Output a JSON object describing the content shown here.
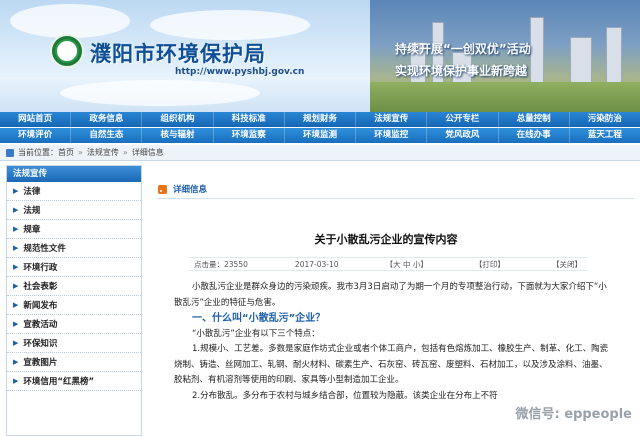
{
  "header": {
    "site_title": "濮阳市环境保护局",
    "site_url": "http://www.pyshbj.gov.cn",
    "slogan_line1": "持续开展“一创双优”活动",
    "slogan_line2": "实现环境保护事业新跨越"
  },
  "nav_row1": [
    "网站首页",
    "政务信息",
    "组织机构",
    "科技标准",
    "规划财务",
    "法规宣传",
    "公开专栏",
    "总量控制",
    "污染防治"
  ],
  "nav_row2": [
    "环境评价",
    "自然生态",
    "核与辐射",
    "环境监察",
    "环境监测",
    "环境监控",
    "党风政风",
    "在线办事",
    "蓝天工程"
  ],
  "breadcrumb": {
    "prefix": "当前位置：",
    "items": [
      "首页",
      "法规宣传",
      "详细信息"
    ],
    "separator": "»"
  },
  "sidebar": {
    "heading": "法规宣传",
    "items": [
      "法律",
      "法规",
      "规章",
      "规范性文件",
      "环境行政",
      "社会表彰",
      "新闻发布",
      "宣教活动",
      "环保知识",
      "宣教图片",
      "环境信用“红黑榜”"
    ]
  },
  "content": {
    "section_label": "详细信息",
    "article_title": "关于小散乱污企业的宣传内容",
    "meta": {
      "hits_label": "点击量：23550",
      "date": "2017-03-10",
      "font_size": "【大 中 小】",
      "print": "【打印】",
      "close": "【关闭】"
    },
    "paragraphs": [
      "小散乱污企业是群众身边的污染顽疾。我市3月3日启动了为期一个月的专项整治行动，下面就为大家介绍下“小散乱污”企业的特征与危害。",
      "一、什么叫“小散乱污”企业？",
      "“小散乱污”企业有以下三个特点：",
      "1.规模小、工艺差。多数是家庭作坊式企业或者个体工商户，包括有色熔炼加工、橡胶生产、制革、化工、陶瓷烧制、铸造、丝网加工、轧钢、耐火材料、碳素生产、石灰窑、砖瓦窑、废塑料、石材加工，以及涉及涂料、油墨、胶粘剂、有机溶剂等使用的印刷、家具等小型制造加工企业。",
      "2.分布散乱。多分布于农村与城乡结合部，位置较为隐蔽。该类企业在分布上不符"
    ],
    "watermark": "微信号: eppeople"
  }
}
